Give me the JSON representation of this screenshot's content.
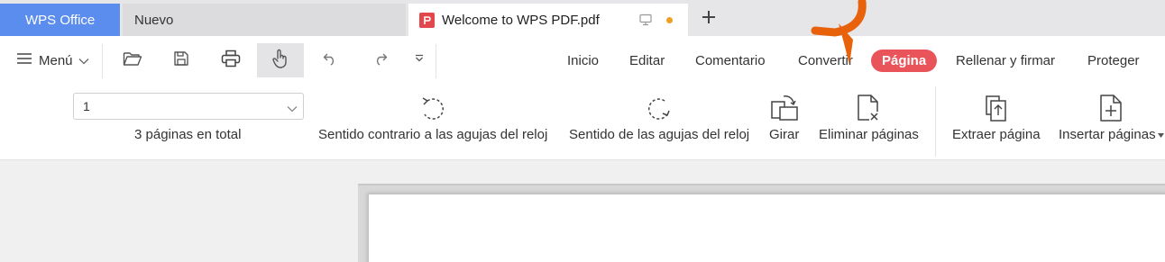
{
  "tabs": {
    "app": "WPS Office",
    "new": "Nuevo",
    "document": "Welcome to WPS PDF.pdf"
  },
  "toolbar": {
    "menu_label": "Menú",
    "quick_icons": [
      "open-folder-icon",
      "save-icon",
      "print-icon",
      "hand-tool-icon",
      "undo-icon",
      "redo-icon",
      "more-chevron-icon"
    ]
  },
  "nav": {
    "items": [
      "Inicio",
      "Editar",
      "Comentario",
      "Convertir",
      "Página",
      "Rellenar y firmar",
      "Proteger"
    ],
    "active": "Página"
  },
  "page_panel": {
    "current_page": "1",
    "total_text": "3 páginas en total"
  },
  "tools": [
    "Sentido contrario a las agujas del reloj",
    "Sentido de las agujas del reloj",
    "Girar",
    "Eliminar páginas",
    "Extraer página",
    "Insertar páginas"
  ],
  "colors": {
    "wps_tab": "#5b8def",
    "active_nav": "#e9535a",
    "annotation_arrow": "#e8620c",
    "unsaved_dot": "#f0a020"
  }
}
